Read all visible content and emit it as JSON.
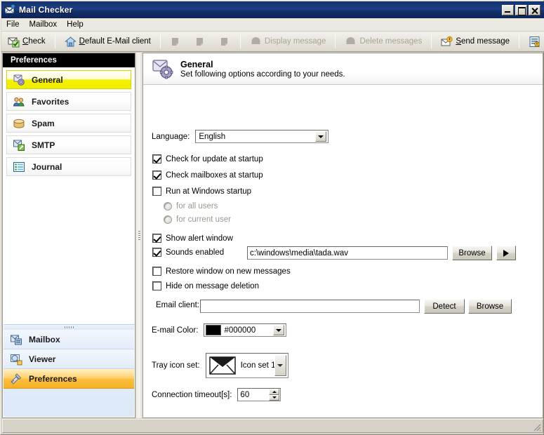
{
  "window": {
    "title": "Mail Checker",
    "icon": "envelope-icon",
    "minimize_label": "Minimize",
    "maximize_label": "Maximize",
    "close_label": "Close"
  },
  "menu": {
    "items": [
      {
        "label": "File",
        "name": "menu-file"
      },
      {
        "label": "Mailbox",
        "name": "menu-mailbox"
      },
      {
        "label": "Help",
        "name": "menu-help"
      }
    ]
  },
  "toolbar": {
    "check_label": "Check",
    "check_icon": "check-mail-icon",
    "default_client_label": "Default E-Mail client",
    "default_client_icon": "home-icon",
    "msg_icon_1": "message-icon",
    "msg_icon_2": "message-icon",
    "msg_icon_3": "message-icon",
    "display_message_label": "Display message",
    "display_message_icon": "display-message-icon",
    "delete_messages_label": "Delete messages",
    "delete_messages_icon": "delete-messages-icon",
    "send_message_label": "Send message",
    "send_message_icon": "send-message-icon",
    "journal_icon": "journal-icon",
    "exit_icon": "red-x-icon"
  },
  "sidebar": {
    "header": "Preferences",
    "items": [
      {
        "label": "General",
        "icon": "general-gear-icon",
        "active": true
      },
      {
        "label": "Favorites",
        "icon": "favorites-people-icon",
        "active": false
      },
      {
        "label": "Spam",
        "icon": "spam-can-icon",
        "active": false
      },
      {
        "label": "SMTP",
        "icon": "smtp-server-icon",
        "active": false
      },
      {
        "label": "Journal",
        "icon": "journal-list-icon",
        "active": false
      }
    ],
    "bottom_nav": [
      {
        "label": "Mailbox",
        "icon": "mailbox-icon",
        "active": false
      },
      {
        "label": "Viewer",
        "icon": "viewer-magnifier-icon",
        "active": false
      },
      {
        "label": "Preferences",
        "icon": "preferences-tools-icon",
        "active": true
      }
    ]
  },
  "page": {
    "title": "General",
    "subtitle": "Set following options according to your needs.",
    "icon": "general-settings-icon"
  },
  "form": {
    "language_label": "Language:",
    "language_value": "English",
    "check_update_label": "Check for update at startup",
    "check_update_checked": true,
    "check_mailboxes_label": "Check mailboxes at startup",
    "check_mailboxes_checked": true,
    "run_at_startup_label": "Run at Windows startup",
    "run_at_startup_checked": false,
    "radio_all_users_label": "for all users",
    "radio_current_user_label": "for current user",
    "show_alert_label": "Show alert window",
    "show_alert_checked": true,
    "sounds_enabled_label": "Sounds enabled",
    "sounds_enabled_checked": true,
    "sound_path_value": "c:\\windows\\media\\tada.wav",
    "sound_browse_label": "Browse",
    "sound_play_label": "Play",
    "restore_window_label": "Restore window  on new messages",
    "restore_window_checked": false,
    "hide_on_delete_label": "Hide on message deletion",
    "hide_on_delete_checked": false,
    "email_client_label": "Email client:",
    "email_client_value": "",
    "email_client_placeholder": "",
    "detect_label": "Detect",
    "email_browse_label": "Browse",
    "email_color_label": "E-mail Color:",
    "email_color_value": "#000000",
    "email_color_swatch": "#000000",
    "tray_icon_label": "Tray icon set:",
    "tray_icon_value": "Icon set 1",
    "tray_icon_preview": "envelope-icon",
    "connection_timeout_label": "Connection timeout[s]:",
    "connection_timeout_value": "60"
  },
  "statusbar": {
    "text": ""
  },
  "colors": {
    "titlebar": "#14326e",
    "active_nav": "#f5f000",
    "active_bottom_nav": "#fcbe3b",
    "panel_bg": "#ffffff",
    "chrome": "#d6d2c8"
  }
}
